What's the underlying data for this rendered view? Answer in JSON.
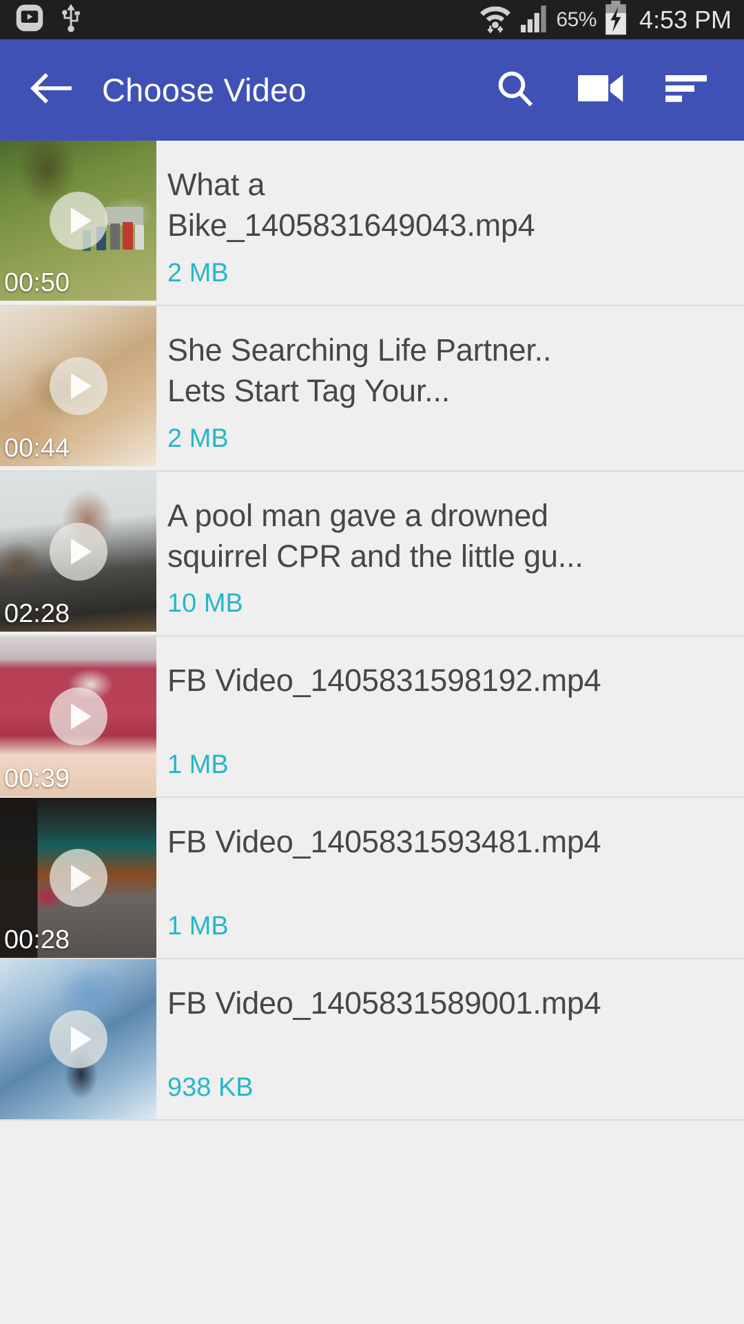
{
  "status_bar": {
    "icons": [
      "screen-recorder-icon",
      "usb-icon",
      "wifi-icon",
      "signal-icon",
      "battery-charging-icon"
    ],
    "battery_percent": "65%",
    "clock": "4:53 PM",
    "background_color": "#1f1f1f"
  },
  "app_bar": {
    "title": "Choose Video",
    "background_color": "#4051b5",
    "back_icon": "arrow-left-icon",
    "actions": [
      {
        "name": "search",
        "icon": "search-icon"
      },
      {
        "name": "record-video",
        "icon": "video-camera-icon"
      },
      {
        "name": "sort",
        "icon": "sort-icon"
      }
    ]
  },
  "theme": {
    "accent_teal": "#25b7c8",
    "list_background": "#efefef",
    "title_text": "#474747"
  },
  "video_list": [
    {
      "title": "What a\nBike_1405831649043.mp4",
      "duration": "00:50",
      "size": "2 MB",
      "scene": "scene-bike"
    },
    {
      "title": "She Searching Life Partner..\nLets Start Tag Your...",
      "duration": "00:44",
      "size": "2 MB",
      "scene": "scene-dogs"
    },
    {
      "title": "A pool man gave a drowned\nsquirrel CPR and the little gu...",
      "duration": "02:28",
      "size": "10 MB",
      "scene": "scene-pool"
    },
    {
      "title": "FB Video_1405831598192.mp4",
      "duration": "00:39",
      "size": "1 MB",
      "scene": "scene-rug"
    },
    {
      "title": "FB Video_1405831593481.mp4",
      "duration": "00:28",
      "size": "1 MB",
      "scene": "scene-stage"
    },
    {
      "title": "FB Video_1405831589001.mp4",
      "duration": "",
      "size": "938 KB",
      "scene": "scene-blue"
    }
  ]
}
